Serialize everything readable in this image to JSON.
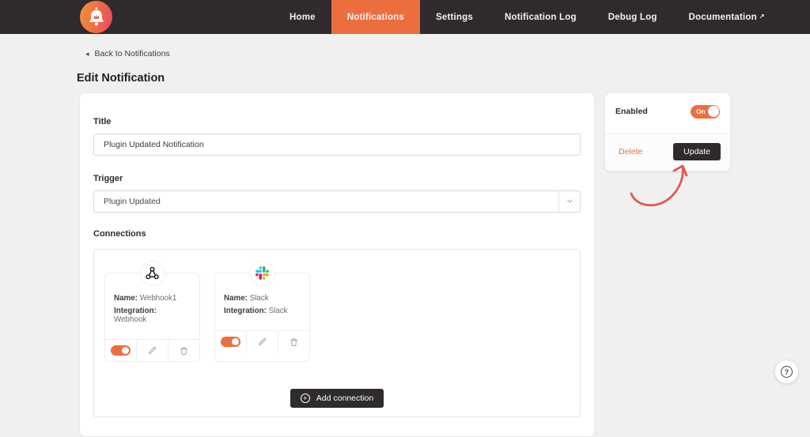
{
  "header": {
    "nav": [
      {
        "label": "Home"
      },
      {
        "label": "Notifications"
      },
      {
        "label": "Settings"
      },
      {
        "label": "Notification Log"
      },
      {
        "label": "Debug Log"
      },
      {
        "label": "Documentation"
      }
    ],
    "external_arrow": "↗"
  },
  "page": {
    "back_arrow": "◂",
    "back_label": "Back to Notifications",
    "title": "Edit Notification"
  },
  "form": {
    "title_label": "Title",
    "title_value": "Plugin Updated Notification",
    "trigger_label": "Trigger",
    "trigger_value": "Plugin Updated",
    "connections_label": "Connections",
    "add_connection": {
      "icon": "+",
      "label": "Add connection"
    }
  },
  "connections": [
    {
      "icon": "webhook-icon",
      "name_label": "Name:",
      "name": "Webhook1",
      "integration_label": "Integration:",
      "integration": "Webhook",
      "enabled": true
    },
    {
      "icon": "slack-icon",
      "name_label": "Name:",
      "name": "Slack",
      "integration_label": "Integration:",
      "integration": "Slack",
      "enabled": true
    }
  ],
  "side_panel": {
    "enabled_label": "Enabled",
    "toggle_state": "On",
    "delete_label": "Delete",
    "update_label": "Update"
  },
  "help": {
    "glyph": "?"
  },
  "colors": {
    "accent": "#ec6e3e",
    "header_bg": "#2e2a2e",
    "page_bg": "#f0f0f0",
    "annotation_arrow": "#e4584a",
    "slack_palette": [
      "#36C5F0",
      "#2EB67D",
      "#ECB22E",
      "#E01E5A"
    ]
  }
}
